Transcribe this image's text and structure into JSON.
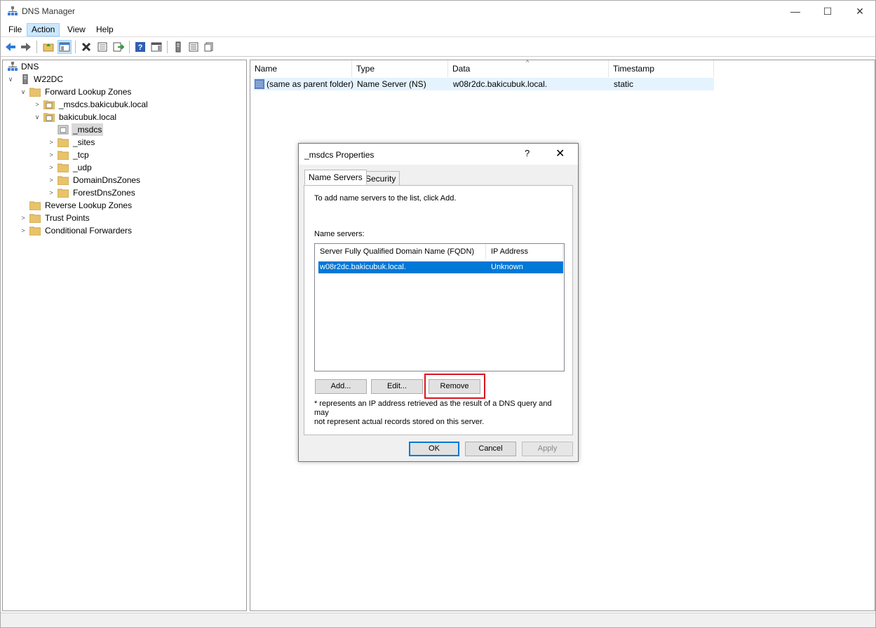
{
  "window": {
    "title": "DNS Manager",
    "minimize_glyph": "—",
    "maximize_glyph": "☐",
    "close_glyph": "✕"
  },
  "menu": [
    "File",
    "Action",
    "View",
    "Help"
  ],
  "toolbar_icons": [
    "back-icon",
    "forward-icon",
    "up-folder-icon",
    "show-hide-console-tree-icon",
    "delete-icon",
    "properties-icon",
    "export-list-icon",
    "help-icon",
    "action-pane-icon",
    "server-icon",
    "list-icon",
    "document-icon"
  ],
  "tree": {
    "root": "DNS",
    "server": "W22DC",
    "forward_lookup_zones": "Forward Lookup Zones",
    "msdcs_zone": "_msdcs.bakicubuk.local",
    "domain_zone": "bakicubuk.local",
    "msdcs": "_msdcs",
    "sites": "_sites",
    "tcp": "_tcp",
    "udp": "_udp",
    "domain_dns_zones": "DomainDnsZones",
    "forest_dns_zones": "ForestDnsZones",
    "reverse_lookup_zones": "Reverse Lookup Zones",
    "trust_points": "Trust Points",
    "conditional_forwarders": "Conditional Forwarders"
  },
  "list": {
    "columns": [
      "Name",
      "Type",
      "Data",
      "Timestamp"
    ],
    "rows": [
      {
        "name": "(same as parent folder)",
        "type": "Name Server (NS)",
        "data": "w08r2dc.bakicubuk.local.",
        "timestamp": "static"
      }
    ]
  },
  "dialog": {
    "title": "_msdcs Properties",
    "help_glyph": "?",
    "close_glyph": "✕",
    "tabs": [
      "Name Servers",
      "Security"
    ],
    "instruction": "To add name servers to the list, click Add.",
    "name_servers_label": "Name servers:",
    "columns": [
      "Server Fully Qualified Domain Name (FQDN)",
      "IP Address"
    ],
    "rows": [
      {
        "fqdn": "w08r2dc.bakicubuk.local.",
        "ip": "Unknown"
      }
    ],
    "add_button": "Add...",
    "edit_button": "Edit...",
    "remove_button": "Remove",
    "note_line1": "* represents an IP address retrieved as the result of a DNS query and may",
    "note_line2": "not represent actual records stored on this server.",
    "ok_button": "OK",
    "cancel_button": "Cancel",
    "apply_button": "Apply"
  },
  "colors": {
    "selection": "#0078d7",
    "highlight_border": "#d9141e",
    "folder": "#e8c36a",
    "row_hover": "#e5f3ff"
  }
}
